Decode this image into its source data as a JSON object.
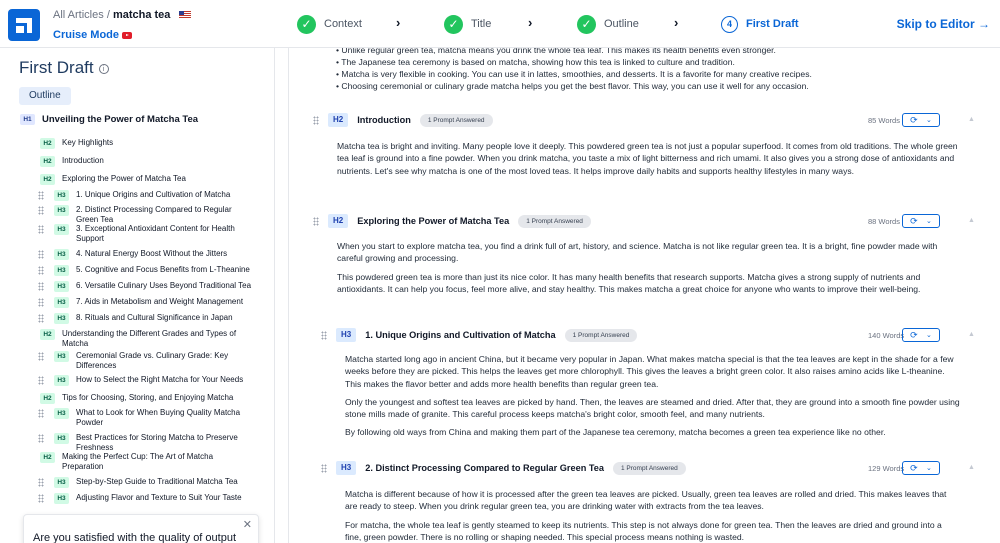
{
  "header": {
    "breadcrumb_root": "All Articles",
    "breadcrumb_sep": "/",
    "breadcrumb_current": "matcha tea",
    "mode": "Cruise Mode",
    "steps": [
      {
        "label": "Context",
        "state": "done"
      },
      {
        "label": "Title",
        "state": "done"
      },
      {
        "label": "Outline",
        "state": "done"
      },
      {
        "label": "First Draft",
        "state": "active",
        "number": "4"
      }
    ],
    "skip_label": "Skip to Editor →"
  },
  "colors": {
    "accent": "#0a66d6",
    "done": "#22c55e"
  },
  "left": {
    "title": "First Draft",
    "tab": "Outline",
    "items": [
      {
        "level": "H1",
        "text": "Unveiling the Power of Matcha Tea"
      },
      {
        "level": "H2",
        "text": "Key Highlights"
      },
      {
        "level": "H2",
        "text": "Introduction"
      },
      {
        "level": "H2",
        "text": "Exploring the Power of Matcha Tea"
      },
      {
        "level": "H3",
        "text": "1. Unique Origins and Cultivation of Matcha"
      },
      {
        "level": "H3",
        "text": "2. Distinct Processing Compared to Regular Green Tea"
      },
      {
        "level": "H3",
        "text": "3. Exceptional Antioxidant Content for Health Support"
      },
      {
        "level": "H3",
        "text": "4. Natural Energy Boost Without the Jitters"
      },
      {
        "level": "H3",
        "text": "5. Cognitive and Focus Benefits from L-Theanine"
      },
      {
        "level": "H3",
        "text": "6. Versatile Culinary Uses Beyond Traditional Tea"
      },
      {
        "level": "H3",
        "text": "7. Aids in Metabolism and Weight Management"
      },
      {
        "level": "H3",
        "text": "8. Rituals and Cultural Significance in Japan"
      },
      {
        "level": "H2",
        "text": "Understanding the Different Grades and Types of Matcha"
      },
      {
        "level": "H3",
        "text": "Ceremonial Grade vs. Culinary Grade: Key Differences"
      },
      {
        "level": "H3",
        "text": "How to Select the Right Matcha for Your Needs"
      },
      {
        "level": "H2",
        "text": "Tips for Choosing, Storing, and Enjoying Matcha"
      },
      {
        "level": "H3",
        "text": "What to Look for When Buying Quality Matcha Powder"
      },
      {
        "level": "H3",
        "text": "Best Practices for Storing Matcha to Preserve Freshness"
      },
      {
        "level": "H2",
        "text": "Making the Perfect Cup: The Art of Matcha Preparation"
      },
      {
        "level": "H3",
        "text": "Step-by-Step Guide to Traditional Matcha Tea"
      },
      {
        "level": "H3",
        "text": "Adjusting Flavor and Texture to Suit Your Taste"
      }
    ],
    "popup": {
      "question": "Are you satisfied with the quality of output",
      "close": "✕"
    }
  },
  "main": {
    "bullets": [
      "Unlike regular green tea, matcha means you drink the whole tea leaf. This makes its health benefits even stronger.",
      "The Japanese tea ceremony is based on matcha, showing how this tea is linked to culture and tradition.",
      "Matcha is very flexible in cooking. You can use it in lattes, smoothies, and desserts. It is a favorite for many creative recipes.",
      "Choosing ceremonial or culinary grade matcha helps you get the best flavor. This way, you can use it well for any occasion."
    ],
    "sections": [
      {
        "level": "H2",
        "title": "Introduction",
        "prompt": "1 Prompt Answered",
        "words": "85 Words",
        "paras": [
          "Matcha tea is bright and inviting. Many people love it deeply. This powdered green tea is not just a popular superfood. It comes from old traditions. The whole green tea leaf is ground into a fine powder. When you drink matcha, you taste a mix of light bitterness and rich umami. It also gives you a strong dose of antioxidants and nutrients. Let's see why matcha is one of the most loved teas. It helps improve daily habits and supports healthy lifestyles in many ways."
        ]
      },
      {
        "level": "H2",
        "title": "Exploring the Power of Matcha Tea",
        "prompt": "1 Prompt Answered",
        "words": "88 Words",
        "paras": [
          "When you start to explore matcha tea, you find a drink full of art, history, and science. Matcha is not like regular green tea. It is a bright, fine powder made with careful growing and processing.",
          "This powdered green tea is more than just its nice color. It has many health benefits that research supports. Matcha gives a strong supply of nutrients and antioxidants. It can help you focus, feel more alive, and stay healthy. This makes matcha a great choice for anyone who wants to improve their well-being."
        ]
      },
      {
        "level": "H3",
        "title": "1. Unique Origins and Cultivation of Matcha",
        "prompt": "1 Prompt Answered",
        "words": "140 Words",
        "paras": [
          "Matcha started long ago in ancient China, but it became very popular in Japan. What makes matcha special is that the tea leaves are kept in the shade for a few weeks before they are picked. This helps the leaves get more chlorophyll. This gives the leaves a bright green color. It also raises amino acids like L-theanine. This makes the flavor better and adds more health benefits than regular green tea.",
          "Only the youngest and softest tea leaves are picked by hand. Then, the leaves are steamed and dried. After that, they are ground into a smooth fine powder using stone mills made of granite. This careful process keeps matcha's bright color, smooth feel, and many nutrients.",
          "By following old ways from China and making them part of the Japanese tea ceremony, matcha becomes a green tea experience like no other."
        ]
      },
      {
        "level": "H3",
        "title": "2. Distinct Processing Compared to Regular Green Tea",
        "prompt": "1 Prompt Answered",
        "words": "129 Words",
        "paras": [
          "Matcha is different because of how it is processed after the green tea leaves are picked. Usually, green tea leaves are rolled and dried. This makes leaves that are ready to steep. When you drink regular green tea, you are drinking water with extracts from the tea leaves.",
          "For matcha, the whole tea leaf is gently steamed to keep its nutrients. This step is not always done for green tea. Then the leaves are dried and ground into a fine, green powder. There is no rolling or shaping needed. This special process means nothing is wasted."
        ]
      }
    ]
  }
}
